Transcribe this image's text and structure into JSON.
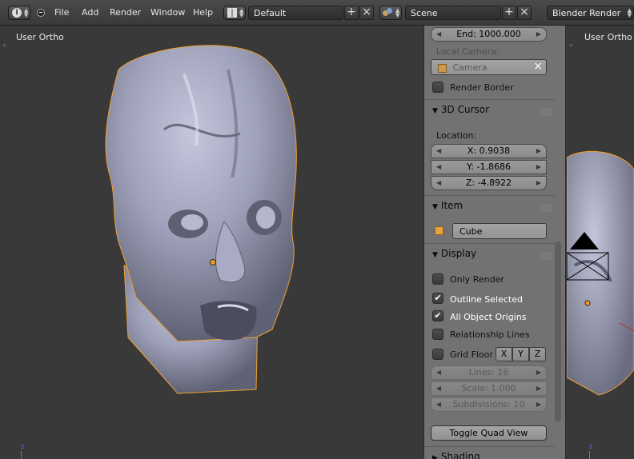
{
  "header": {
    "menu": [
      "File",
      "Add",
      "Render",
      "Window",
      "Help"
    ],
    "screen_layout": "Default",
    "scene": "Scene",
    "render_engine": "Blender Render"
  },
  "viewport_left": {
    "label": "User Ortho",
    "axis": "z"
  },
  "viewport_right": {
    "label": "User Ortho",
    "axis": "z"
  },
  "properties": {
    "end_field": "End: 1000.000",
    "local_camera_label": "Local Camera:",
    "local_camera_value": "Camera",
    "render_border": "Render Border",
    "cursor_panel": {
      "title": "3D Cursor",
      "location_label": "Location:",
      "x": "X: 0.9038",
      "y": "Y: -1.8686",
      "z": "Z: -4.8922"
    },
    "item_panel": {
      "title": "Item",
      "name": "Cube"
    },
    "display_panel": {
      "title": "Display",
      "only_render": "Only Render",
      "outline_selected": "Outline Selected",
      "all_object_origins": "All Object Origins",
      "relationship_lines": "Relationship Lines",
      "grid_floor": "Grid Floor",
      "axis_x": "X",
      "axis_y": "Y",
      "axis_z": "Z",
      "lines": "Lines: 16",
      "scale": "Scale: 1.000",
      "subdivisions": "Subdivisions: 10",
      "toggle_quad_view": "Toggle Quad View",
      "check_states": {
        "only_render": false,
        "outline_selected": true,
        "all_object_origins": true,
        "relationship_lines": false,
        "grid_floor": false
      }
    },
    "shading_panel": {
      "title": "Shading"
    }
  },
  "colors": {
    "selection_outline": "#f0a030",
    "mesh": "#9a9cb4",
    "viewport_bg": "#393939",
    "panel_bg": "#727272"
  }
}
